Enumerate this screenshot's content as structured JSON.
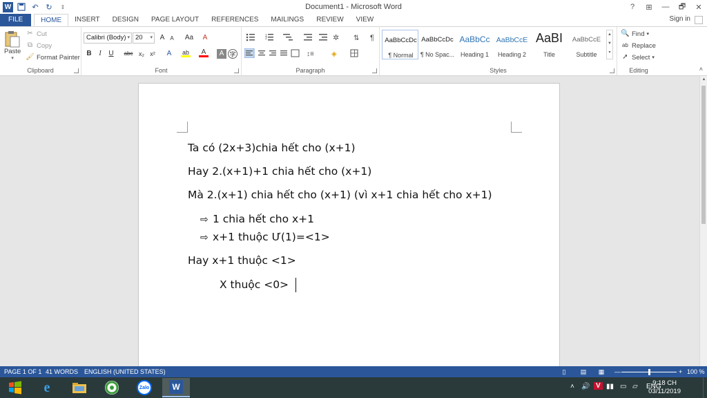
{
  "window": {
    "title": "Document1 - Microsoft Word",
    "help": "?",
    "min": "—",
    "max": "🗗",
    "close": "✕",
    "ribbon_display": "⊞"
  },
  "quick_access": {
    "undo": "↶",
    "redo": "↻",
    "customize": "⇕"
  },
  "tabs": [
    "FILE",
    "HOME",
    "INSERT",
    "DESIGN",
    "PAGE LAYOUT",
    "REFERENCES",
    "MAILINGS",
    "REVIEW",
    "VIEW"
  ],
  "active_tab": "HOME",
  "sign_in": "Sign in",
  "clipboard": {
    "label": "Clipboard",
    "paste": "Paste",
    "cut": "Cut",
    "copy": "Copy",
    "format_painter": "Format Painter"
  },
  "font": {
    "label": "Font",
    "name": "Calibri (Body)",
    "size": "20",
    "grow": "A",
    "shrink": "A",
    "case": "Aa",
    "clear": "A",
    "bold": "B",
    "italic": "I",
    "underline": "U",
    "strike": "abc",
    "subscript": "x₂",
    "superscript": "x²",
    "effects": "A",
    "highlight": "ab",
    "color": "A",
    "shade": "A",
    "enclose": "字"
  },
  "paragraph": {
    "label": "Paragraph",
    "show_marks": "¶"
  },
  "styles": {
    "label": "Styles",
    "items": [
      {
        "sample": "AaBbCcDc",
        "name": "¶ Normal"
      },
      {
        "sample": "AaBbCcDc",
        "name": "¶ No Spac..."
      },
      {
        "sample": "AaBbCc",
        "name": "Heading 1"
      },
      {
        "sample": "AaBbCcE",
        "name": "Heading 2"
      },
      {
        "sample": "AaBI",
        "name": "Title"
      },
      {
        "sample": "AaBbCcE",
        "name": "Subtitle"
      }
    ]
  },
  "editing": {
    "label": "Editing",
    "find": "Find",
    "replace": "Replace",
    "select": "Select"
  },
  "document": {
    "lines": [
      "Ta có (2x+3)chia hết cho (x+1)",
      "Hay 2.(x+1)+1 chia hết cho (x+1)",
      "Mà 2.(x+1) chia hết cho (x+1) (vì x+1 chia hết cho x+1)",
      "1 chia hết cho x+1",
      "x+1 thuộc Ư(1)=<1>",
      "Hay x+1 thuộc <1>",
      "X thuộc <0>"
    ],
    "arrow_glyph": "⇨"
  },
  "status": {
    "page": "PAGE 1 OF 1",
    "words": "41 WORDS",
    "language": "ENGLISH (UNITED STATES)",
    "zoom": "100 %",
    "zoom_minus": "—",
    "zoom_plus": "+",
    "zoom_level": 0.5
  },
  "taskbar": {
    "language": "ENG",
    "time": "9:18 CH",
    "date": "03/11/2019",
    "zalo": "Zalo",
    "word": "W",
    "tray_up": "˄",
    "volume": "🔊",
    "vpn": "V"
  },
  "colors": {
    "accent": "#2b579a",
    "highlight": "#ffff00",
    "font_color": "#ff0000"
  }
}
